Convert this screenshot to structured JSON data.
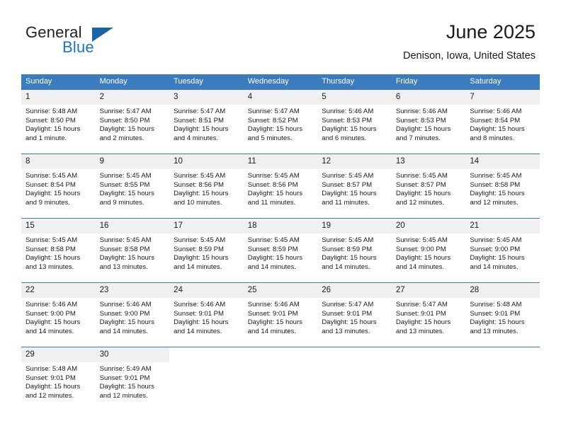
{
  "brand": {
    "line1": "General",
    "line2": "Blue",
    "mark": "triangle-logo"
  },
  "header": {
    "title": "June 2025",
    "subtitle": "Denison, Iowa, United States"
  },
  "colors": {
    "header_blue": "#3a7cbe",
    "daynum_band": "#f0f0f0",
    "brand_dark": "#231f20",
    "brand_blue": "#1b75bb",
    "text": "#1a1a1a"
  },
  "weekdays": [
    "Sunday",
    "Monday",
    "Tuesday",
    "Wednesday",
    "Thursday",
    "Friday",
    "Saturday"
  ],
  "labels": {
    "sunrise_prefix": "Sunrise:",
    "sunset_prefix": "Sunset:",
    "daylight_prefix": "Daylight:"
  },
  "weeks": [
    [
      {
        "day": "1",
        "sunrise": "Sunrise: 5:48 AM",
        "sunset": "Sunset: 8:50 PM",
        "daylight_l1": "Daylight: 15 hours",
        "daylight_l2": "and 1 minute."
      },
      {
        "day": "2",
        "sunrise": "Sunrise: 5:47 AM",
        "sunset": "Sunset: 8:50 PM",
        "daylight_l1": "Daylight: 15 hours",
        "daylight_l2": "and 2 minutes."
      },
      {
        "day": "3",
        "sunrise": "Sunrise: 5:47 AM",
        "sunset": "Sunset: 8:51 PM",
        "daylight_l1": "Daylight: 15 hours",
        "daylight_l2": "and 4 minutes."
      },
      {
        "day": "4",
        "sunrise": "Sunrise: 5:47 AM",
        "sunset": "Sunset: 8:52 PM",
        "daylight_l1": "Daylight: 15 hours",
        "daylight_l2": "and 5 minutes."
      },
      {
        "day": "5",
        "sunrise": "Sunrise: 5:46 AM",
        "sunset": "Sunset: 8:53 PM",
        "daylight_l1": "Daylight: 15 hours",
        "daylight_l2": "and 6 minutes."
      },
      {
        "day": "6",
        "sunrise": "Sunrise: 5:46 AM",
        "sunset": "Sunset: 8:53 PM",
        "daylight_l1": "Daylight: 15 hours",
        "daylight_l2": "and 7 minutes."
      },
      {
        "day": "7",
        "sunrise": "Sunrise: 5:46 AM",
        "sunset": "Sunset: 8:54 PM",
        "daylight_l1": "Daylight: 15 hours",
        "daylight_l2": "and 8 minutes."
      }
    ],
    [
      {
        "day": "8",
        "sunrise": "Sunrise: 5:45 AM",
        "sunset": "Sunset: 8:54 PM",
        "daylight_l1": "Daylight: 15 hours",
        "daylight_l2": "and 9 minutes."
      },
      {
        "day": "9",
        "sunrise": "Sunrise: 5:45 AM",
        "sunset": "Sunset: 8:55 PM",
        "daylight_l1": "Daylight: 15 hours",
        "daylight_l2": "and 9 minutes."
      },
      {
        "day": "10",
        "sunrise": "Sunrise: 5:45 AM",
        "sunset": "Sunset: 8:56 PM",
        "daylight_l1": "Daylight: 15 hours",
        "daylight_l2": "and 10 minutes."
      },
      {
        "day": "11",
        "sunrise": "Sunrise: 5:45 AM",
        "sunset": "Sunset: 8:56 PM",
        "daylight_l1": "Daylight: 15 hours",
        "daylight_l2": "and 11 minutes."
      },
      {
        "day": "12",
        "sunrise": "Sunrise: 5:45 AM",
        "sunset": "Sunset: 8:57 PM",
        "daylight_l1": "Daylight: 15 hours",
        "daylight_l2": "and 11 minutes."
      },
      {
        "day": "13",
        "sunrise": "Sunrise: 5:45 AM",
        "sunset": "Sunset: 8:57 PM",
        "daylight_l1": "Daylight: 15 hours",
        "daylight_l2": "and 12 minutes."
      },
      {
        "day": "14",
        "sunrise": "Sunrise: 5:45 AM",
        "sunset": "Sunset: 8:58 PM",
        "daylight_l1": "Daylight: 15 hours",
        "daylight_l2": "and 12 minutes."
      }
    ],
    [
      {
        "day": "15",
        "sunrise": "Sunrise: 5:45 AM",
        "sunset": "Sunset: 8:58 PM",
        "daylight_l1": "Daylight: 15 hours",
        "daylight_l2": "and 13 minutes."
      },
      {
        "day": "16",
        "sunrise": "Sunrise: 5:45 AM",
        "sunset": "Sunset: 8:58 PM",
        "daylight_l1": "Daylight: 15 hours",
        "daylight_l2": "and 13 minutes."
      },
      {
        "day": "17",
        "sunrise": "Sunrise: 5:45 AM",
        "sunset": "Sunset: 8:59 PM",
        "daylight_l1": "Daylight: 15 hours",
        "daylight_l2": "and 14 minutes."
      },
      {
        "day": "18",
        "sunrise": "Sunrise: 5:45 AM",
        "sunset": "Sunset: 8:59 PM",
        "daylight_l1": "Daylight: 15 hours",
        "daylight_l2": "and 14 minutes."
      },
      {
        "day": "19",
        "sunrise": "Sunrise: 5:45 AM",
        "sunset": "Sunset: 8:59 PM",
        "daylight_l1": "Daylight: 15 hours",
        "daylight_l2": "and 14 minutes."
      },
      {
        "day": "20",
        "sunrise": "Sunrise: 5:45 AM",
        "sunset": "Sunset: 9:00 PM",
        "daylight_l1": "Daylight: 15 hours",
        "daylight_l2": "and 14 minutes."
      },
      {
        "day": "21",
        "sunrise": "Sunrise: 5:45 AM",
        "sunset": "Sunset: 9:00 PM",
        "daylight_l1": "Daylight: 15 hours",
        "daylight_l2": "and 14 minutes."
      }
    ],
    [
      {
        "day": "22",
        "sunrise": "Sunrise: 5:46 AM",
        "sunset": "Sunset: 9:00 PM",
        "daylight_l1": "Daylight: 15 hours",
        "daylight_l2": "and 14 minutes."
      },
      {
        "day": "23",
        "sunrise": "Sunrise: 5:46 AM",
        "sunset": "Sunset: 9:00 PM",
        "daylight_l1": "Daylight: 15 hours",
        "daylight_l2": "and 14 minutes."
      },
      {
        "day": "24",
        "sunrise": "Sunrise: 5:46 AM",
        "sunset": "Sunset: 9:01 PM",
        "daylight_l1": "Daylight: 15 hours",
        "daylight_l2": "and 14 minutes."
      },
      {
        "day": "25",
        "sunrise": "Sunrise: 5:46 AM",
        "sunset": "Sunset: 9:01 PM",
        "daylight_l1": "Daylight: 15 hours",
        "daylight_l2": "and 14 minutes."
      },
      {
        "day": "26",
        "sunrise": "Sunrise: 5:47 AM",
        "sunset": "Sunset: 9:01 PM",
        "daylight_l1": "Daylight: 15 hours",
        "daylight_l2": "and 13 minutes."
      },
      {
        "day": "27",
        "sunrise": "Sunrise: 5:47 AM",
        "sunset": "Sunset: 9:01 PM",
        "daylight_l1": "Daylight: 15 hours",
        "daylight_l2": "and 13 minutes."
      },
      {
        "day": "28",
        "sunrise": "Sunrise: 5:48 AM",
        "sunset": "Sunset: 9:01 PM",
        "daylight_l1": "Daylight: 15 hours",
        "daylight_l2": "and 13 minutes."
      }
    ],
    [
      {
        "day": "29",
        "sunrise": "Sunrise: 5:48 AM",
        "sunset": "Sunset: 9:01 PM",
        "daylight_l1": "Daylight: 15 hours",
        "daylight_l2": "and 12 minutes."
      },
      {
        "day": "30",
        "sunrise": "Sunrise: 5:49 AM",
        "sunset": "Sunset: 9:01 PM",
        "daylight_l1": "Daylight: 15 hours",
        "daylight_l2": "and 12 minutes."
      },
      {
        "day": "",
        "sunrise": "",
        "sunset": "",
        "daylight_l1": "",
        "daylight_l2": ""
      },
      {
        "day": "",
        "sunrise": "",
        "sunset": "",
        "daylight_l1": "",
        "daylight_l2": ""
      },
      {
        "day": "",
        "sunrise": "",
        "sunset": "",
        "daylight_l1": "",
        "daylight_l2": ""
      },
      {
        "day": "",
        "sunrise": "",
        "sunset": "",
        "daylight_l1": "",
        "daylight_l2": ""
      },
      {
        "day": "",
        "sunrise": "",
        "sunset": "",
        "daylight_l1": "",
        "daylight_l2": ""
      }
    ]
  ]
}
